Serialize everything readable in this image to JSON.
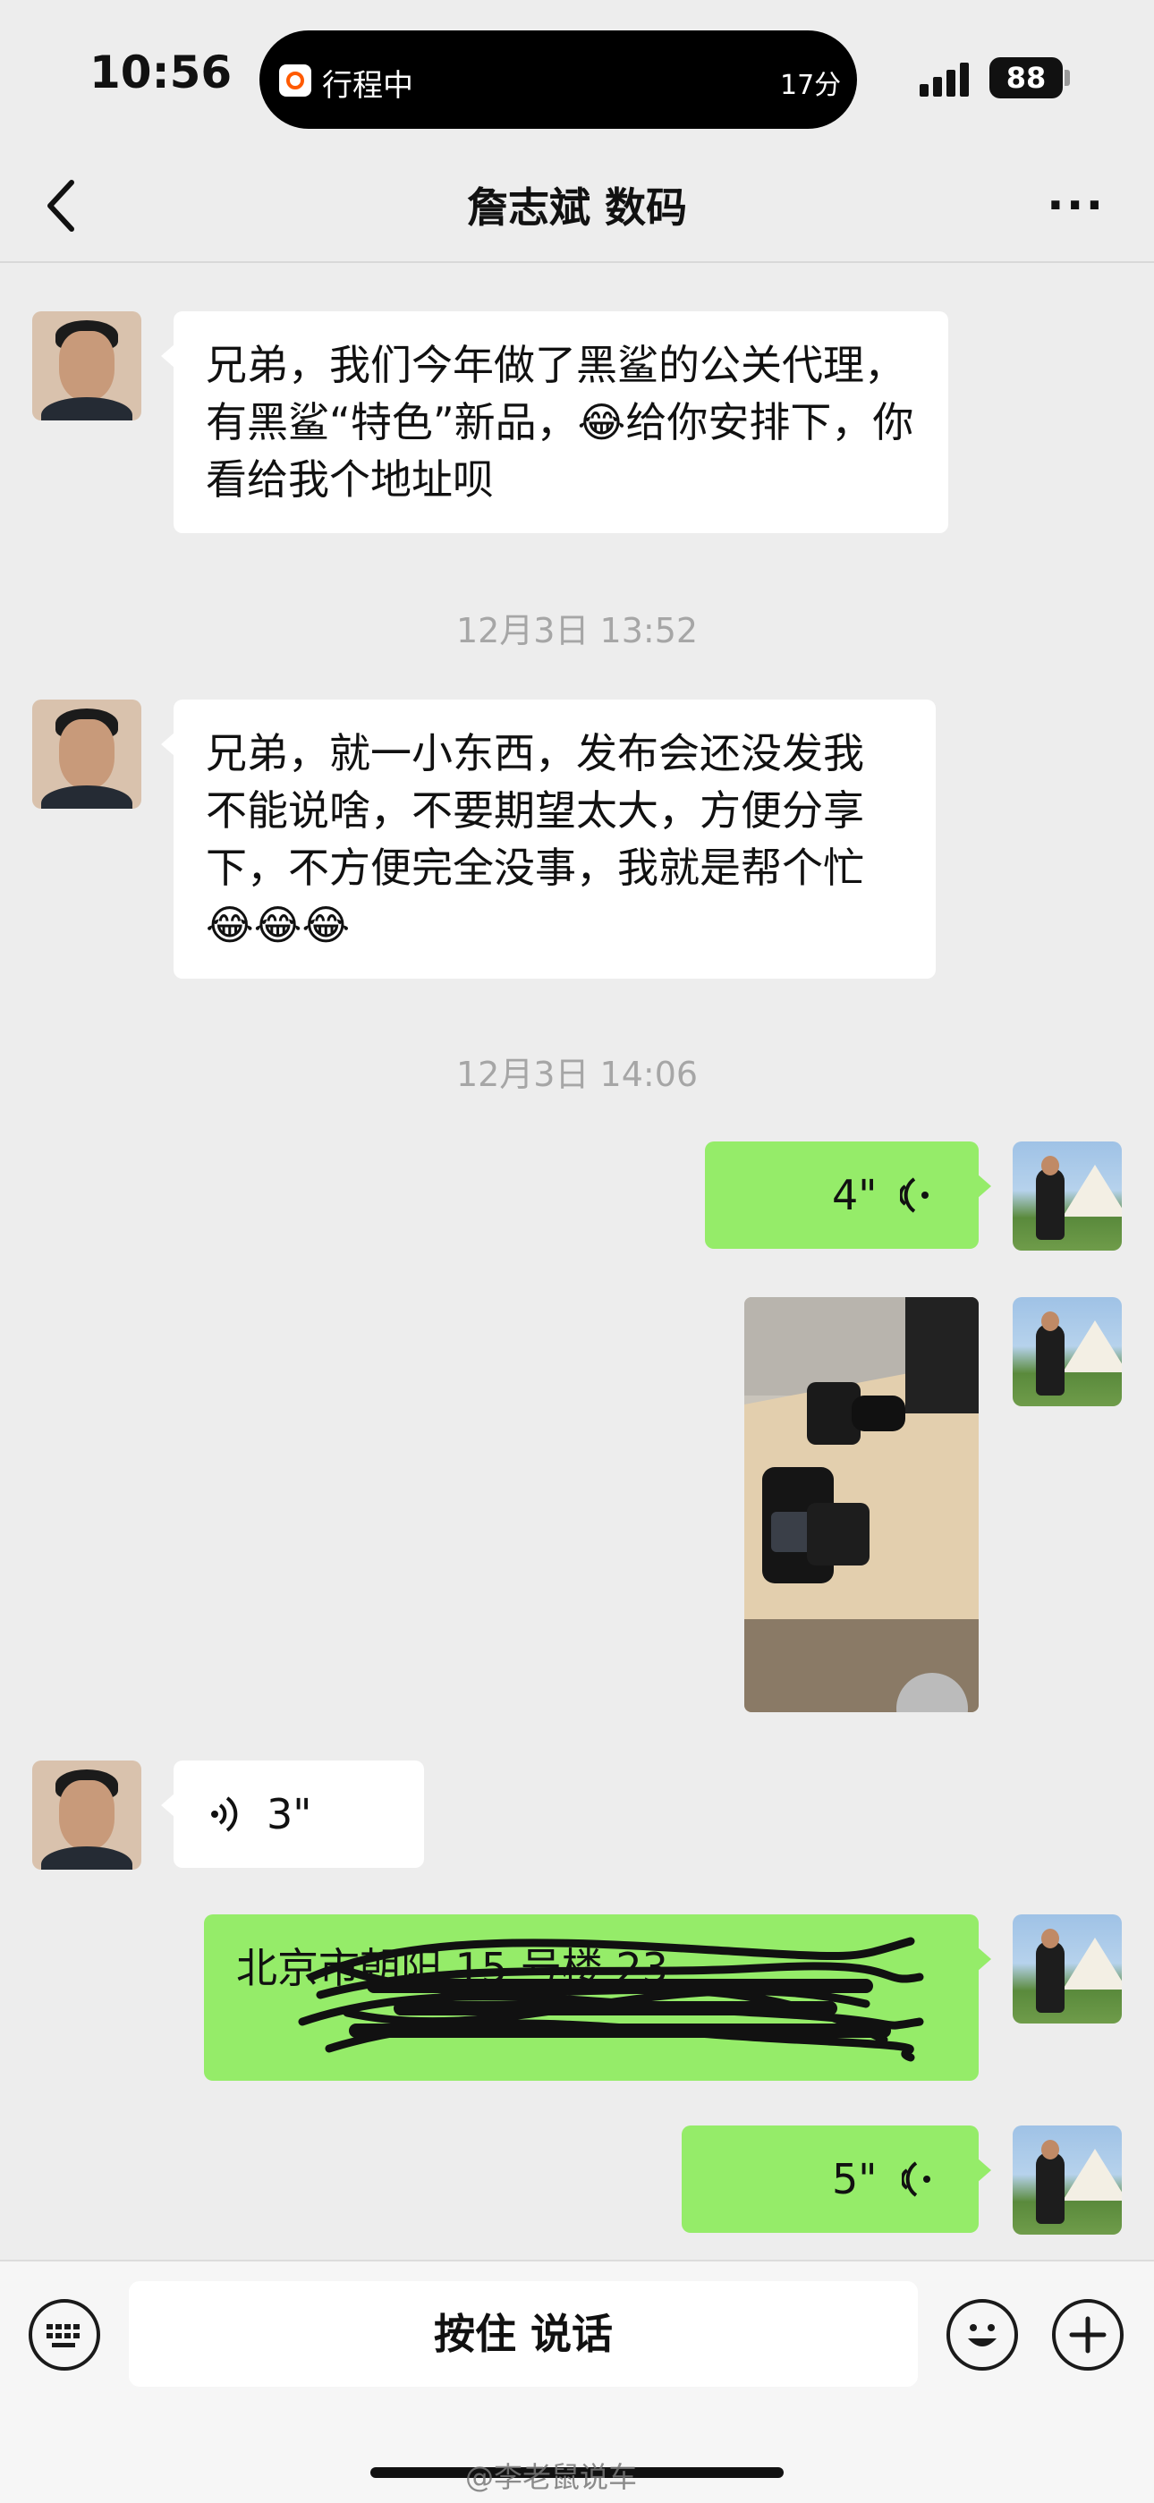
{
  "status_bar": {
    "time": "10:56",
    "island_text": "行程中",
    "island_minutes": "17分",
    "battery": "88"
  },
  "nav": {
    "title": "詹志斌 数码",
    "back_icon": "chevron-left-icon",
    "more_icon": "ellipsis-icon"
  },
  "messages": [
    {
      "side": "left",
      "type": "text",
      "text": "兄弟，我们今年做了黑鲨的公关代理，有黑鲨“特色”新品，😂给你安排下，你看给我个地址呗"
    },
    {
      "type": "timestamp",
      "text": "12月3日 13:52"
    },
    {
      "side": "left",
      "type": "text",
      "text": "兄弟，就一小东西，发布会还没发我不能说啥，不要期望太大，方便分享下，不方便完全没事，我就是帮个忙😂😂😂"
    },
    {
      "type": "timestamp",
      "text": "12月3日 14:06"
    },
    {
      "side": "right",
      "type": "voice",
      "duration": "4\""
    },
    {
      "side": "right",
      "type": "image",
      "description_icon": "photo-icon"
    },
    {
      "side": "left",
      "type": "voice",
      "duration": "3\""
    },
    {
      "side": "right",
      "type": "text",
      "text": "北京市朝阳 15 号楼 23"
    },
    {
      "side": "right",
      "type": "voice",
      "duration": "5\""
    }
  ],
  "input_bar": {
    "talk_label": "按住 说话",
    "keyboard_icon": "keyboard-icon",
    "emoji_icon": "emoji-icon",
    "plus_icon": "plus-icon"
  },
  "watermark": "@李老鼠说车",
  "colors": {
    "background": "#ededed",
    "bubble_green": "#95ec69",
    "bubble_white": "#ffffff"
  }
}
